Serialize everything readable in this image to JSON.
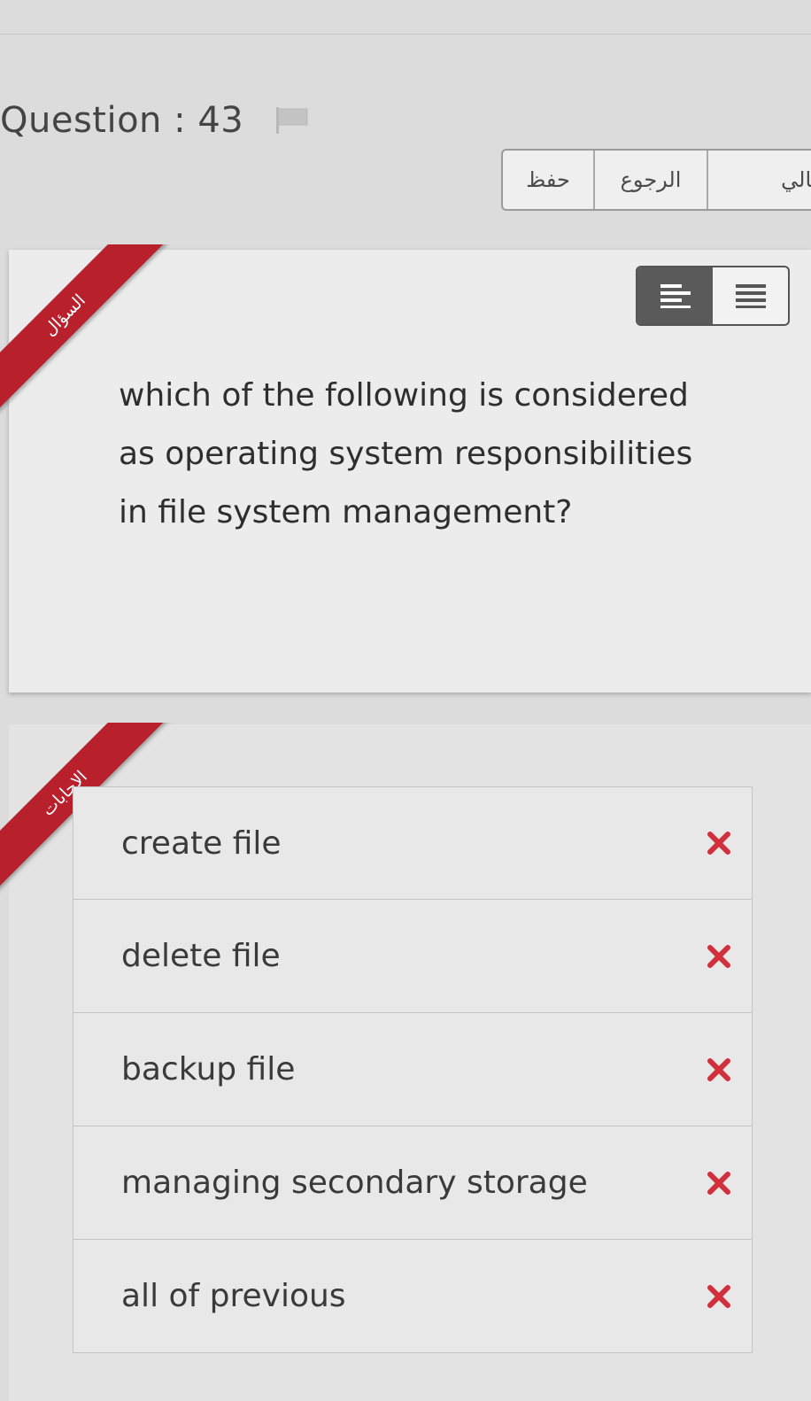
{
  "header": {
    "title": "Question : 43"
  },
  "nav": {
    "save": "حفظ",
    "back": "الرجوع",
    "next": "التالي"
  },
  "question_card": {
    "ribbon": "السؤال",
    "text": "which of the following is considered as operating system responsibilities in file system  management?"
  },
  "answers_card": {
    "ribbon": "الاجابات",
    "options": [
      "create file",
      "delete file",
      "backup file",
      "managing secondary storage",
      "all of previous"
    ]
  },
  "colors": {
    "ribbon": "#b8202c",
    "wrong_mark": "#d0303c"
  },
  "icons": {
    "flag": "flag-icon",
    "align_left": "align-left-icon",
    "align_justify": "align-justify-icon",
    "wrong": "close-icon"
  }
}
